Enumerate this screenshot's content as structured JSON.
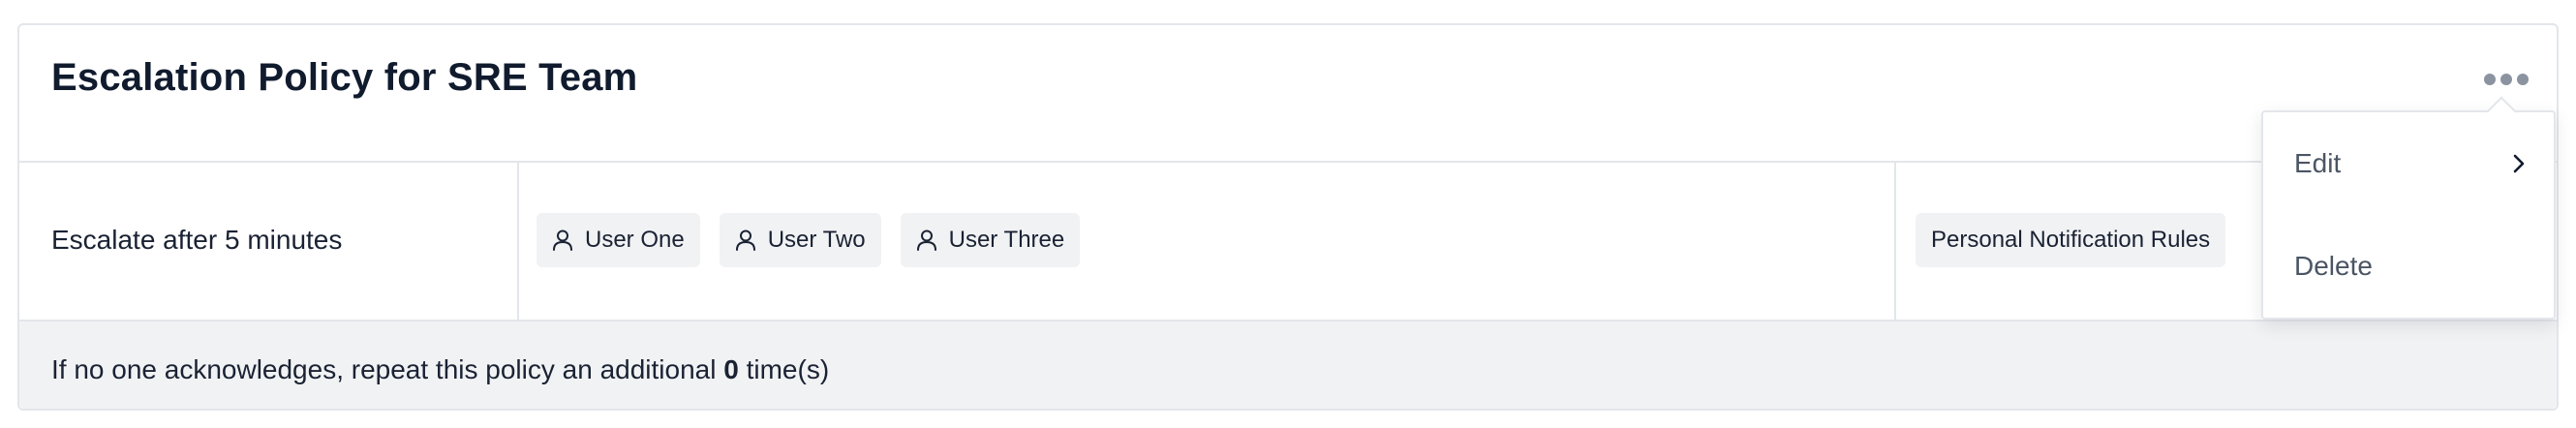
{
  "policy": {
    "title": "Escalation Policy for SRE Team"
  },
  "rule": {
    "timing": "Escalate after 5 minutes",
    "users": [
      {
        "label": "User One",
        "icon": "user-icon"
      },
      {
        "label": "User Two",
        "icon": "user-icon"
      },
      {
        "label": "User Three",
        "icon": "user-icon"
      }
    ],
    "notification_rules_label": "Personal Notification Rules"
  },
  "footer": {
    "prefix": "If no one acknowledges, repeat this policy an additional ",
    "repeat_count": "0",
    "suffix": " time(s)"
  },
  "menu": {
    "trigger_icon": "more-horizontal-icon",
    "items": [
      {
        "label": "Edit",
        "icon": "chevron-right-icon"
      },
      {
        "label": "Delete"
      }
    ]
  },
  "colors": {
    "text": "#1a2233",
    "muted": "#8c93a0",
    "border": "#e3e6ea",
    "chip_bg": "#f1f2f4"
  }
}
